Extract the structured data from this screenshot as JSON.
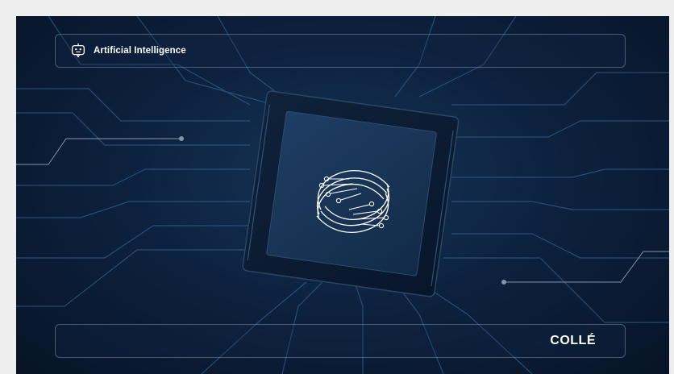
{
  "header": {
    "title": "Artificial Intelligence",
    "icon": "robot-chat-icon"
  },
  "footer": {
    "brand": "COLLÉ"
  },
  "visual": {
    "center_logo": "swirl-circuit-logo",
    "background": "circuit-board-chip"
  },
  "colors": {
    "background_dark": "#071426",
    "background_mid": "#173457",
    "trace": "#3b6a9a",
    "text": "#ffffff"
  }
}
